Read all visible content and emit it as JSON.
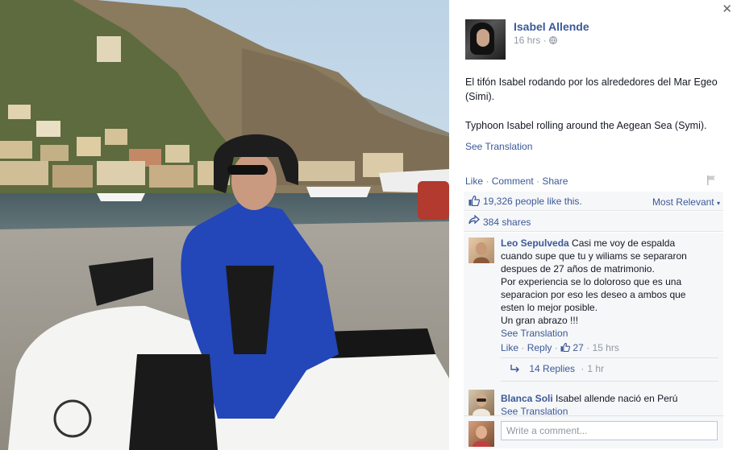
{
  "post": {
    "author": "Isabel Allende",
    "time": "16 hrs",
    "privacy_sep": "·",
    "text_es": "El tifón Isabel rodando por los alrededores del Mar Egeo (Simi).",
    "text_en": "Typhoon Isabel rolling around the Aegean Sea (Symi).",
    "see_translation": "See Translation"
  },
  "actions": {
    "like": "Like",
    "comment": "Comment",
    "share": "Share",
    "sep": " · "
  },
  "likes": {
    "text": "19,326 people like this.",
    "sort": "Most Relevant"
  },
  "shares": {
    "text": "384 shares"
  },
  "comments": [
    {
      "name": "Leo Sepulveda",
      "lines": [
        "Casi me voy de espalda",
        "cuando supe que tu y wiliams se separaron",
        "despues de 27 años de matrimonio.",
        "Por experiencia se lo doloroso que es una",
        "separacion por eso les deseo a ambos que",
        "esten lo mejor posible.",
        "Un gran abrazo !!!"
      ],
      "see_translation": "See Translation",
      "like": "Like",
      "reply": "Reply",
      "likes": "27",
      "time": "15 hrs",
      "replies": "14 Replies",
      "replies_time": "1 hr"
    },
    {
      "name": "Blanca Soli",
      "text": "Isabel allende nació en Perú",
      "see_translation": "See Translation"
    }
  ],
  "composer": {
    "placeholder": "Write a comment..."
  },
  "icons": [
    "close-icon",
    "globe-icon",
    "flag-icon",
    "like-thumb-icon",
    "share-arrow-icon",
    "reply-arrow-icon"
  ],
  "colors": {
    "link": "#3b5998",
    "meta": "#9197a3",
    "bar": "#f6f7f9"
  }
}
